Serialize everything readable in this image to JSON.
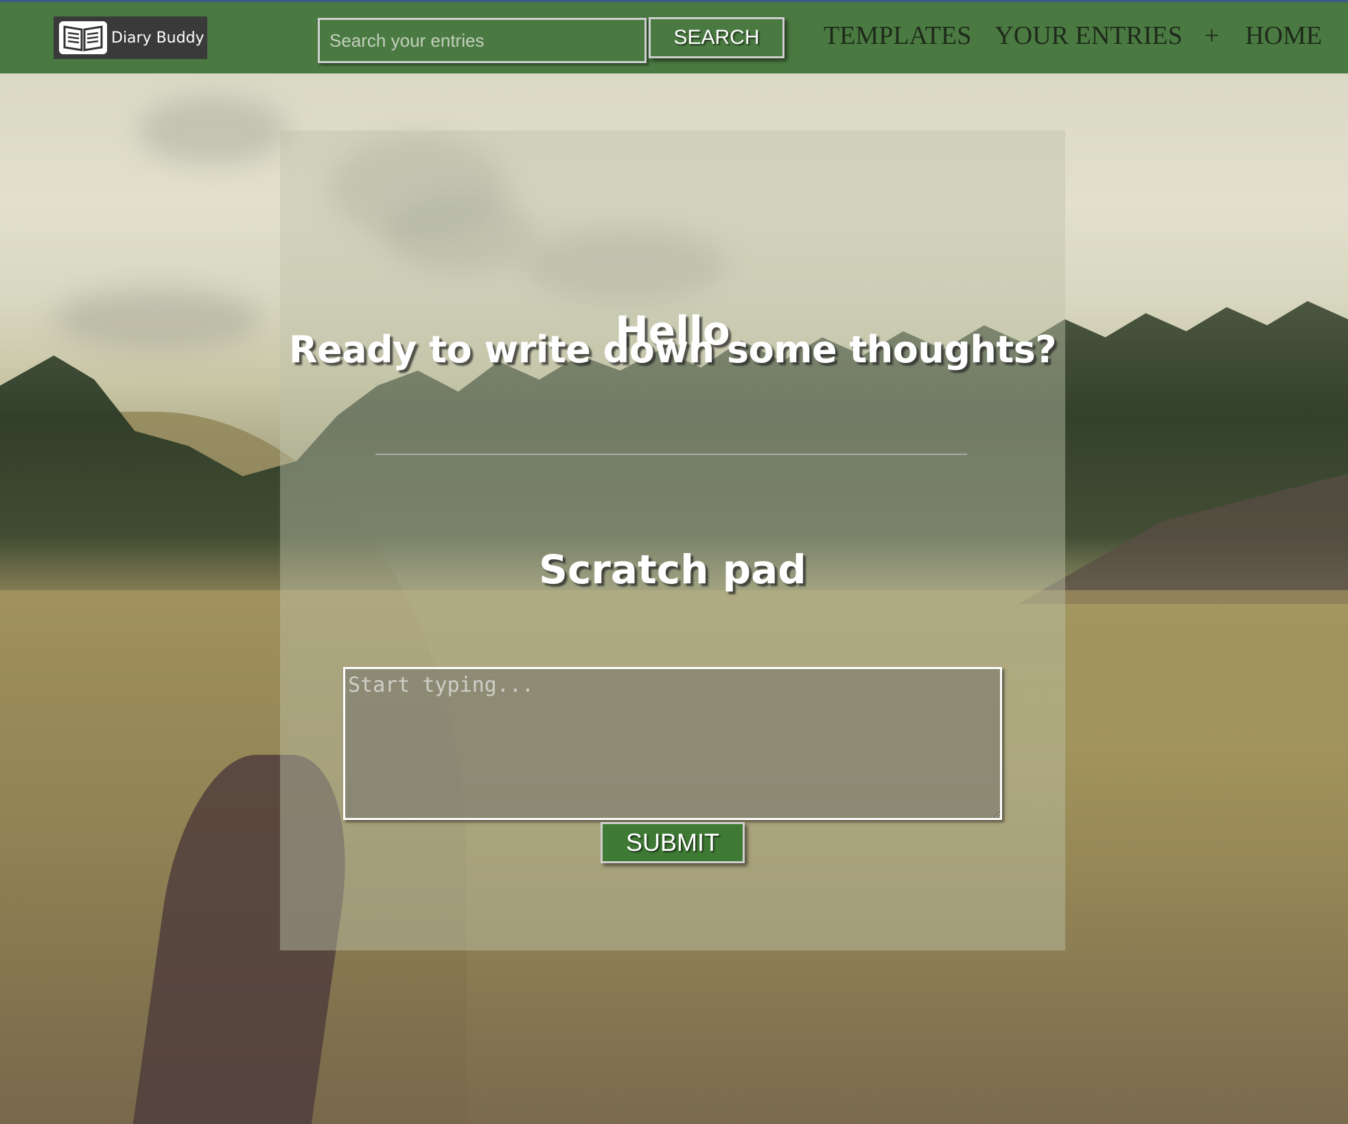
{
  "brand": {
    "name": "Diary Buddy",
    "icon": "open-book-icon"
  },
  "search": {
    "placeholder": "Search your entries",
    "value": "",
    "button_label": "SEARCH"
  },
  "nav": {
    "templates": "TEMPLATES",
    "your_entries": "YOUR ENTRIES",
    "add": "+",
    "home": "HOME"
  },
  "main": {
    "greeting": "Hello",
    "prompt": "Ready to write down some thoughts?",
    "scratch_pad": {
      "title": "Scratch pad",
      "placeholder": "Start typing...",
      "value": "",
      "submit_label": "SUBMIT"
    }
  },
  "colors": {
    "navbar": "#4a7a41",
    "submit": "#3f7a34",
    "text_light": "#ffffff",
    "nav_text": "#1e2a1a"
  }
}
